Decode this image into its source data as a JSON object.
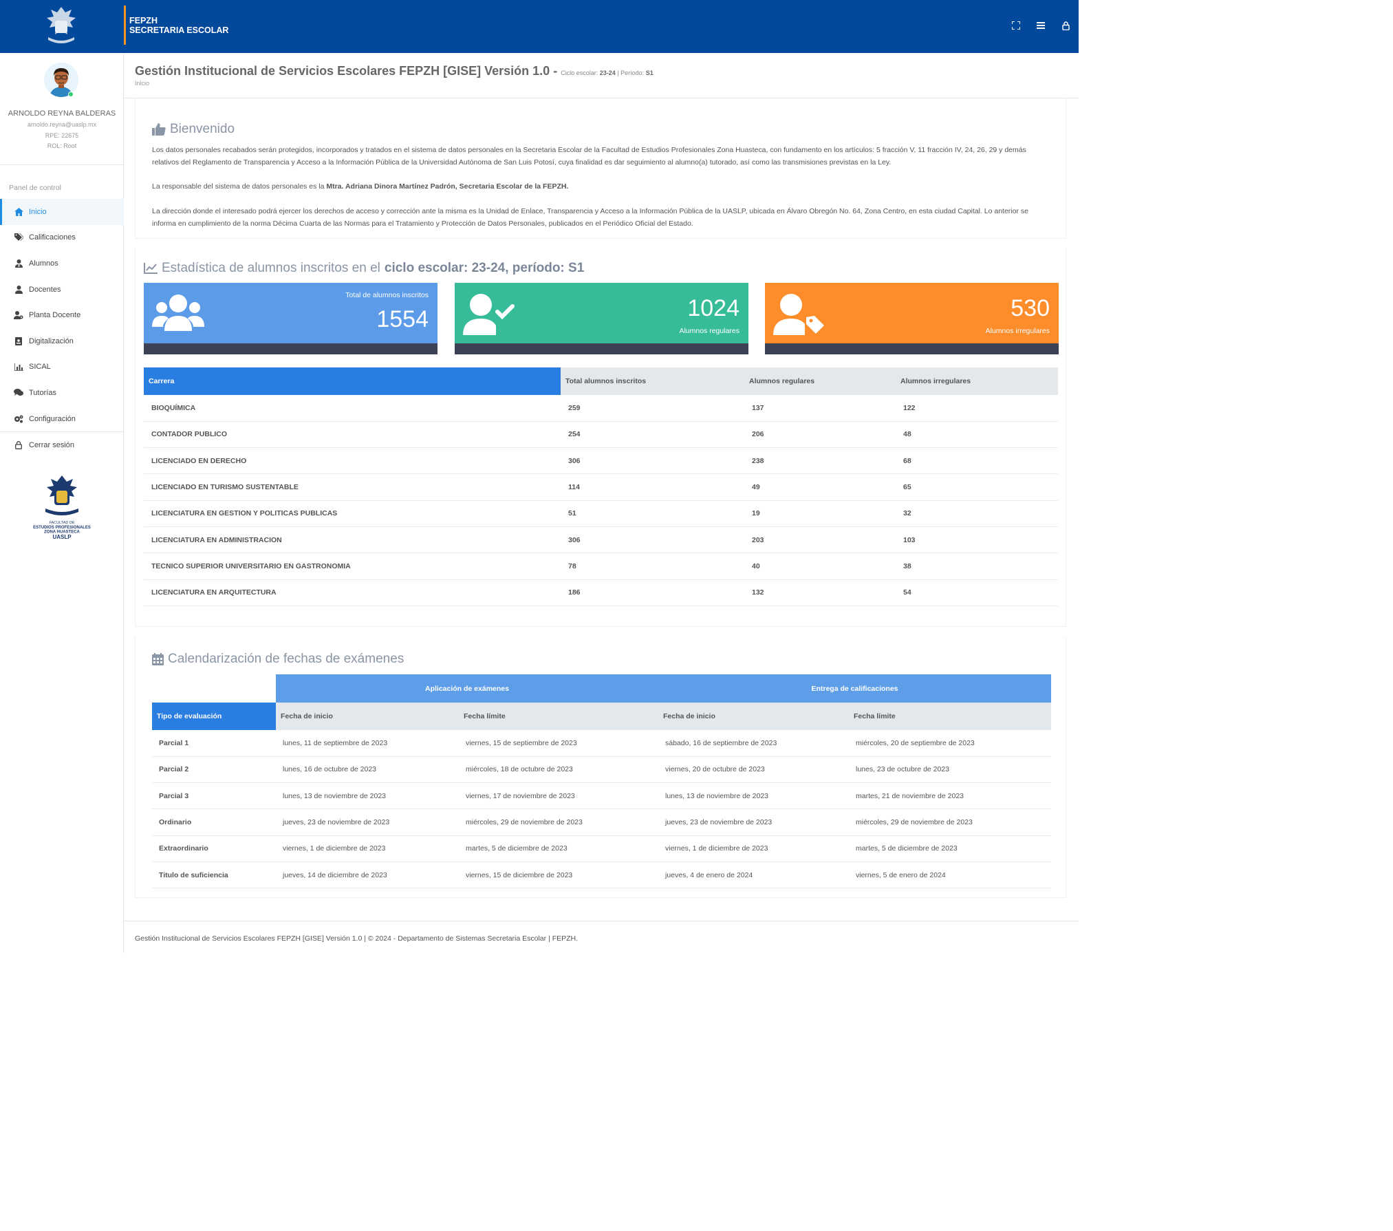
{
  "header": {
    "line1": "FEPZH",
    "line2": "SECRETARIA ESCOLAR",
    "icons": [
      "expand-icon",
      "menu-icon",
      "lock-icon"
    ]
  },
  "user": {
    "name": "ARNOLDO REYNA BALDERAS",
    "email": "arnoldo.reyna@uaslp.mx",
    "rpe_label": "RPE:",
    "rpe": "22675",
    "rol_label": "ROL:",
    "rol": "Root"
  },
  "sidebar": {
    "panel_label": "Panel de control",
    "items": [
      {
        "label": "Inicio",
        "icon": "home-icon"
      },
      {
        "label": "Calificaciones",
        "icon": "tags-icon"
      },
      {
        "label": "Alumnos",
        "icon": "user-tie-icon"
      },
      {
        "label": "Docentes",
        "icon": "user-icon"
      },
      {
        "label": "Planta Docente",
        "icon": "users-gear-icon"
      },
      {
        "label": "Digitalización",
        "icon": "id-badge-icon"
      },
      {
        "label": "SICAL",
        "icon": "chart-bar-icon"
      },
      {
        "label": "Tutorías",
        "icon": "comments-icon"
      },
      {
        "label": "Configuración",
        "icon": "cogs-icon"
      }
    ],
    "logout": "Cerrar sesión",
    "logo_lines": [
      "FACULTAD DE",
      "ESTUDIOS PROFESIONALES",
      "ZONA HUASTECA",
      "UASLP"
    ]
  },
  "page": {
    "title": "Gestión Institucional de Servicios Escolares FEPZH [GISE] Versión 1.0 -",
    "cycle_label": "Ciclo escolar:",
    "cycle": "23-24",
    "period_label": "| Período:",
    "period": "S1",
    "breadcrumb": "Inicio"
  },
  "welcome": {
    "title": "Bienvenido",
    "p1": "Los datos personales recabados serán protegidos, incorporados y tratados en el sistema de datos personales en la Secretaria Escolar de la Facultad de Estudios Profesionales Zona Huasteca, con fundamento en los artículos: 5 fracción V, 11 fracción IV, 24, 26, 29 y demás relativos del Reglamento de Transparencia y Acceso a la Información Pública de la Universidad Autónoma de San Luis Potosí, cuya finalidad es dar seguimiento al alumno(a) tutorado, así como las transmisiones previstas en la Ley.",
    "p2_prefix": "La responsable del sistema de datos personales es la ",
    "p2_bold": "Mtra. Adriana Dinora Martínez Padrón, Secretaria Escolar de la FEPZH.",
    "p3": "La dirección donde el interesado podrá ejercer los derechos de acceso y corrección ante la misma es la Unidad de Enlace, Transparencia y Acceso a la Información Pública de la UASLP, ubicada en Álvaro Obregón No. 64, Zona Centro, en esta ciudad Capital. Lo anterior se informa en cumplimiento de la norma Décima Cuarta de las Normas para el Tratamiento y Protección de Datos Personales, publicados en el Periódico Oficial del Estado."
  },
  "stats": {
    "title_prefix": "Estadística de alumnos inscritos en el",
    "title_bold": "ciclo escolar: 23-24, período: S1",
    "cards": [
      {
        "label": "Total de alumnos inscritos",
        "value": "1554",
        "color": "#5b9be8",
        "icon": "users-icon"
      },
      {
        "label": "Alumnos regulares",
        "value": "1024",
        "color": "#36bc98",
        "icon": "user-check-icon"
      },
      {
        "label": "Alumnos irregulares",
        "value": "530",
        "color": "#fd8c2b",
        "icon": "user-tag-icon"
      }
    ],
    "table": {
      "headers": [
        "Carrera",
        "Total alumnos inscritos",
        "Alumnos regulares",
        "Alumnos irregulares"
      ],
      "rows": [
        [
          "BIOQUÍMICA",
          "259",
          "137",
          "122"
        ],
        [
          "CONTADOR PUBLICO",
          "254",
          "206",
          "48"
        ],
        [
          "LICENCIADO EN DERECHO",
          "306",
          "238",
          "68"
        ],
        [
          "LICENCIADO EN TURISMO SUSTENTABLE",
          "114",
          "49",
          "65"
        ],
        [
          "LICENCIATURA EN GESTION Y POLITICAS PUBLICAS",
          "51",
          "19",
          "32"
        ],
        [
          "LICENCIATURA EN ADMINISTRACION",
          "306",
          "203",
          "103"
        ],
        [
          "TECNICO SUPERIOR UNIVERSITARIO EN GASTRONOMIA",
          "78",
          "40",
          "38"
        ],
        [
          "LICENCIATURA EN ARQUITECTURA",
          "186",
          "132",
          "54"
        ]
      ]
    }
  },
  "calendar": {
    "title": "Calendarización de fechas de exámenes",
    "group1": "Aplicación de exámenes",
    "group2": "Entrega de calificaciones",
    "headers": [
      "Tipo de evaluación",
      "Fecha de inicio",
      "Fecha límite",
      "Fecha de inicio",
      "Fecha límite"
    ],
    "rows": [
      [
        "Parcial 1",
        "lunes, 11 de septiembre de 2023",
        "viernes, 15 de septiembre de 2023",
        "sábado, 16 de septiembre de 2023",
        "miércoles, 20 de septiembre de 2023"
      ],
      [
        "Parcial 2",
        "lunes, 16 de octubre de 2023",
        "miércoles, 18 de octubre de 2023",
        "viernes, 20 de octubre de 2023",
        "lunes, 23 de octubre de 2023"
      ],
      [
        "Parcial 3",
        "lunes, 13 de noviembre de 2023",
        "viernes, 17 de noviembre de 2023",
        "lunes, 13 de noviembre de 2023",
        "martes, 21 de noviembre de 2023"
      ],
      [
        "Ordinario",
        "jueves, 23 de noviembre de 2023",
        "miércoles, 29 de noviembre de 2023",
        "jueves, 23 de noviembre de 2023",
        "miércoles, 29 de noviembre de 2023"
      ],
      [
        "Extraordinario",
        "viernes, 1 de diciembre de 2023",
        "martes, 5 de diciembre de 2023",
        "viernes, 1 de diciembre de 2023",
        "martes, 5 de diciembre de 2023"
      ],
      [
        "Titulo de suficiencia",
        "jueves, 14 de diciembre de 2023",
        "viernes, 15 de diciembre de 2023",
        "jueves, 4 de enero de 2024",
        "viernes, 5 de enero de 2024"
      ]
    ]
  },
  "footer": {
    "text": "Gestión Institucional de Servicios Escolares FEPZH [GISE] Versión 1.0 | © 2024 - Departamento de Sistemas Secretaria Escolar | FEPZH."
  }
}
